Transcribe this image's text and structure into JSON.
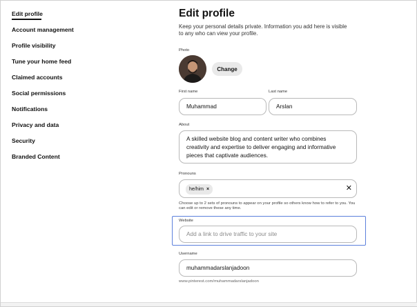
{
  "sidebar": {
    "items": [
      {
        "label": "Edit profile"
      },
      {
        "label": "Account management"
      },
      {
        "label": "Profile visibility"
      },
      {
        "label": "Tune your home feed"
      },
      {
        "label": "Claimed accounts"
      },
      {
        "label": "Social permissions"
      },
      {
        "label": "Notifications"
      },
      {
        "label": "Privacy and data"
      },
      {
        "label": "Security"
      },
      {
        "label": "Branded Content"
      }
    ],
    "active": "Edit profile"
  },
  "main": {
    "title": "Edit profile",
    "description": "Keep your personal details private. Information you add here is visible to any who can view your profile.",
    "photo": {
      "label": "Photo",
      "change_label": "Change"
    },
    "first_name": {
      "label": "First name",
      "value": "Muhammad"
    },
    "last_name": {
      "label": "Last name",
      "value": "Arslan"
    },
    "about": {
      "label": "About",
      "value": "A skilled website blog and content writer who combines creativity and expertise to deliver engaging and informative pieces that captivate audiences."
    },
    "pronouns": {
      "label": "Pronouns",
      "chip": "he/him",
      "chip_remove": "×",
      "clear": "✕",
      "help": "Choose up to 2 sets of pronouns to appear on your profile so others know how to refer to you. You can edit or remove these any time."
    },
    "website": {
      "label": "Website",
      "placeholder": "Add a link to drive traffic to your site",
      "value": ""
    },
    "username": {
      "label": "Username",
      "value": "muhammadarslanjadoon",
      "url": "www.pinterest.com/muhammadarslanjadoon"
    }
  },
  "colors": {
    "accent_focus": "#5b7fdc",
    "button_bg": "#e9e9e9"
  }
}
